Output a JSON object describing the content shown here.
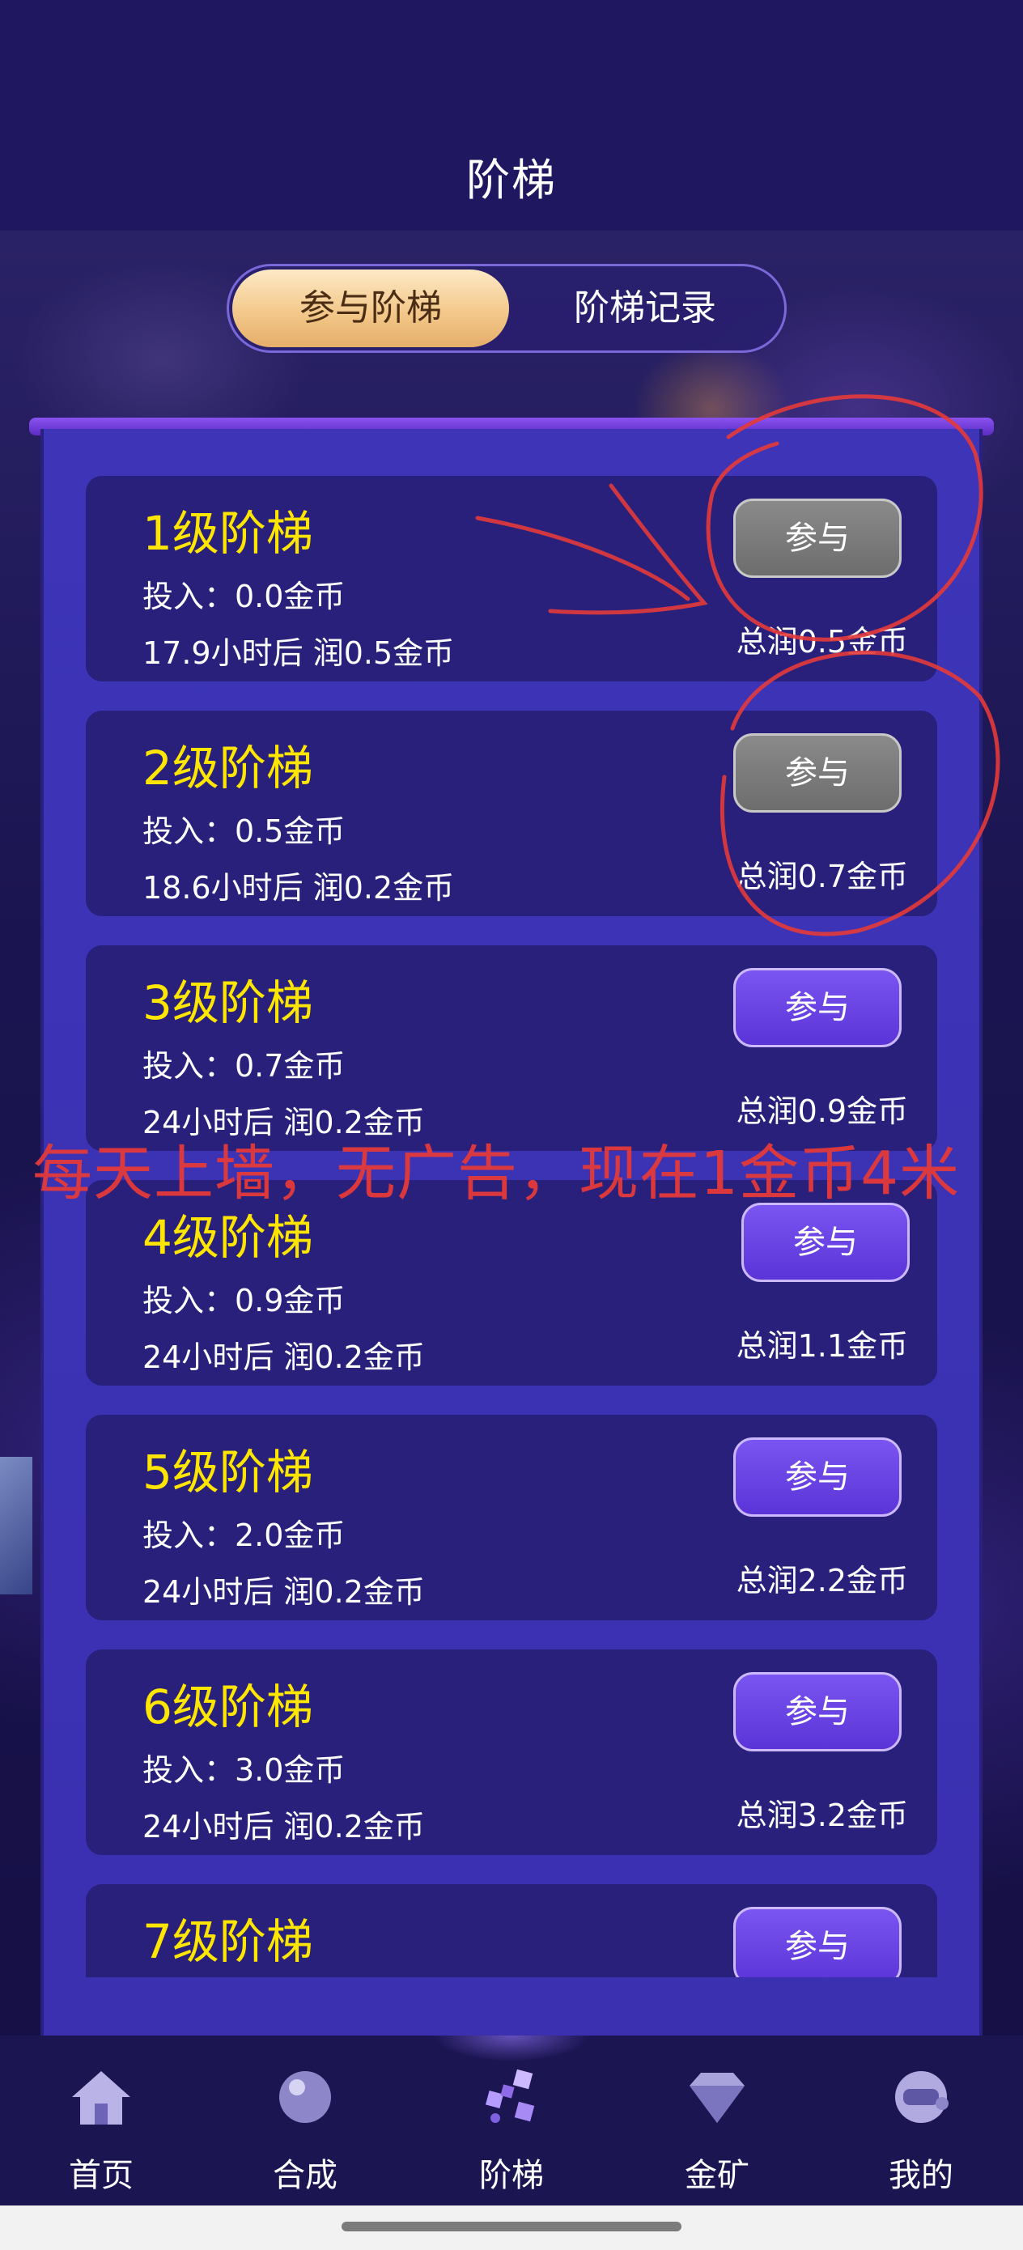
{
  "header": {
    "title": "阶梯"
  },
  "tabs": [
    {
      "label": "参与阶梯",
      "active": true
    },
    {
      "label": "阶梯记录",
      "active": false
    }
  ],
  "ladders": [
    {
      "title": "1级阶梯",
      "invest": "投入：0.0金币",
      "time": "17.9小时后 润0.5金币",
      "button": "参与",
      "total": "总润0.5金币",
      "enabled": false
    },
    {
      "title": "2级阶梯",
      "invest": "投入：0.5金币",
      "time": "18.6小时后 润0.2金币",
      "button": "参与",
      "total": "总润0.7金币",
      "enabled": false
    },
    {
      "title": "3级阶梯",
      "invest": "投入：0.7金币",
      "time": "24小时后 润0.2金币",
      "button": "参与",
      "total": "总润0.9金币",
      "enabled": true
    },
    {
      "title": "4级阶梯",
      "invest": "投入：0.9金币",
      "time": "24小时后 润0.2金币",
      "button": "参与",
      "total": "总润1.1金币",
      "enabled": true
    },
    {
      "title": "5级阶梯",
      "invest": "投入：2.0金币",
      "time": "24小时后 润0.2金币",
      "button": "参与",
      "total": "总润2.2金币",
      "enabled": true
    },
    {
      "title": "6级阶梯",
      "invest": "投入：3.0金币",
      "time": "24小时后 润0.2金币",
      "button": "参与",
      "total": "总润3.2金币",
      "enabled": true
    },
    {
      "title": "7级阶梯",
      "invest": "",
      "time": "",
      "button": "参与",
      "total": "",
      "enabled": true
    }
  ],
  "annotation": {
    "text": "每天上墙，无广告，现在1金币4米",
    "color": "#e43a3a"
  },
  "nav": [
    {
      "label": "首页",
      "icon": "house-icon"
    },
    {
      "label": "合成",
      "icon": "orb-icon"
    },
    {
      "label": "阶梯",
      "icon": "cubes-icon",
      "active": true
    },
    {
      "label": "金矿",
      "icon": "diamond-icon"
    },
    {
      "label": "我的",
      "icon": "helmet-icon"
    }
  ],
  "colors": {
    "accent": "#ffe600",
    "button": "#5b34d8",
    "button_disabled": "#7a7a7a",
    "panel": "#3a30b0",
    "card": "#28207a"
  }
}
